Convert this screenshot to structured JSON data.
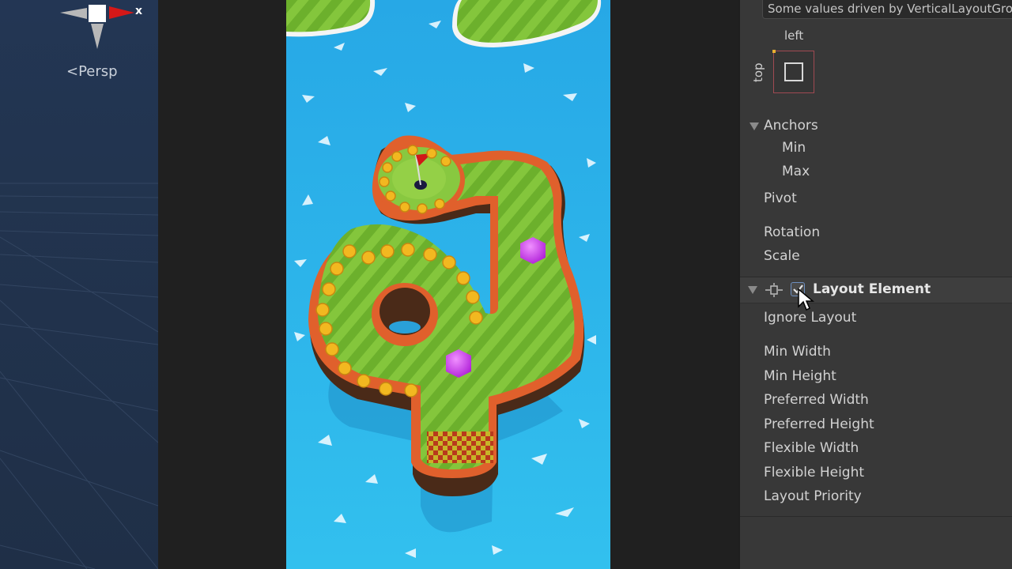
{
  "scene": {
    "persp_label": "Persp",
    "gizmo_x_label": "x"
  },
  "inspector": {
    "driven_notice": "Some values driven by VerticalLayoutGroup",
    "anchor_left_label": "left",
    "anchor_top_label": "top",
    "anchors_label": "Anchors",
    "anchors_min_label": "Min",
    "anchors_max_label": "Max",
    "pivot_label": "Pivot",
    "rotation_label": "Rotation",
    "scale_label": "Scale",
    "layout_element": {
      "title": "Layout Element",
      "enabled": true,
      "fields": [
        "Ignore Layout",
        "Min Width",
        "Min Height",
        "Preferred Width",
        "Preferred Height",
        "Flexible Width",
        "Flexible Height",
        "Layout Priority"
      ]
    }
  },
  "colors": {
    "scene_bg": "#233654",
    "water": "#2ab0e8",
    "grass": "#7cc23a",
    "wall": "#d4552a",
    "inspector_bg": "#383838",
    "gem": "#c040e0",
    "coin": "#f2b820"
  }
}
